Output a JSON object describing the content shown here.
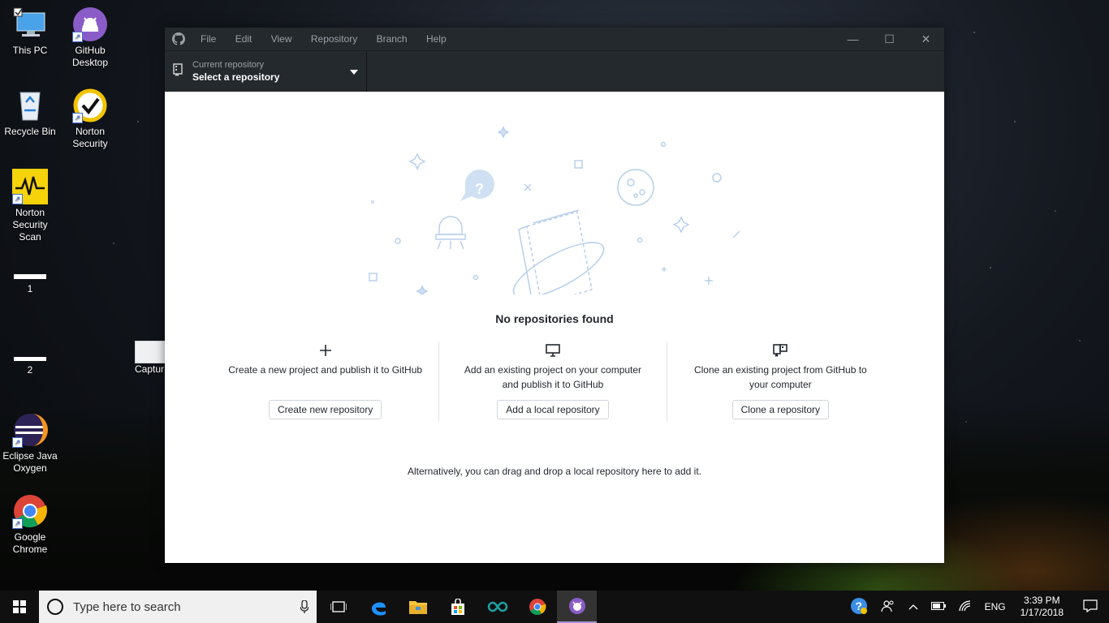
{
  "desktop": {
    "icons": [
      {
        "label": "This PC"
      },
      {
        "label": "GitHub Desktop"
      },
      {
        "label": "Recycle Bin"
      },
      {
        "label": "Norton Security"
      },
      {
        "label": "Norton Security Scan"
      },
      {
        "label": "1"
      },
      {
        "label": "2"
      },
      {
        "label": "Captur"
      },
      {
        "label": "Eclipse Java Oxygen"
      },
      {
        "label": "Google Chrome"
      }
    ]
  },
  "window": {
    "menu": [
      "File",
      "Edit",
      "View",
      "Repository",
      "Branch",
      "Help"
    ],
    "repo_select": {
      "caption": "Current repository",
      "value": "Select a repository"
    },
    "empty_title": "No repositories found",
    "actions": [
      {
        "icon": "plus-icon",
        "description": "Create a new project and publish it to GitHub",
        "button": "Create new repository"
      },
      {
        "icon": "desktop-icon",
        "description": "Add an existing project on your computer and publish it to GitHub",
        "button": "Add a local repository"
      },
      {
        "icon": "repo-clone-icon",
        "description": "Clone an existing project from GitHub to your computer",
        "button": "Clone a repository"
      }
    ],
    "alternative_text": "Alternatively, you can drag and drop a local repository here to add it."
  },
  "taskbar": {
    "search_placeholder": "Type here to search",
    "language": "ENG",
    "time": "3:39 PM",
    "date": "1/17/2018"
  }
}
